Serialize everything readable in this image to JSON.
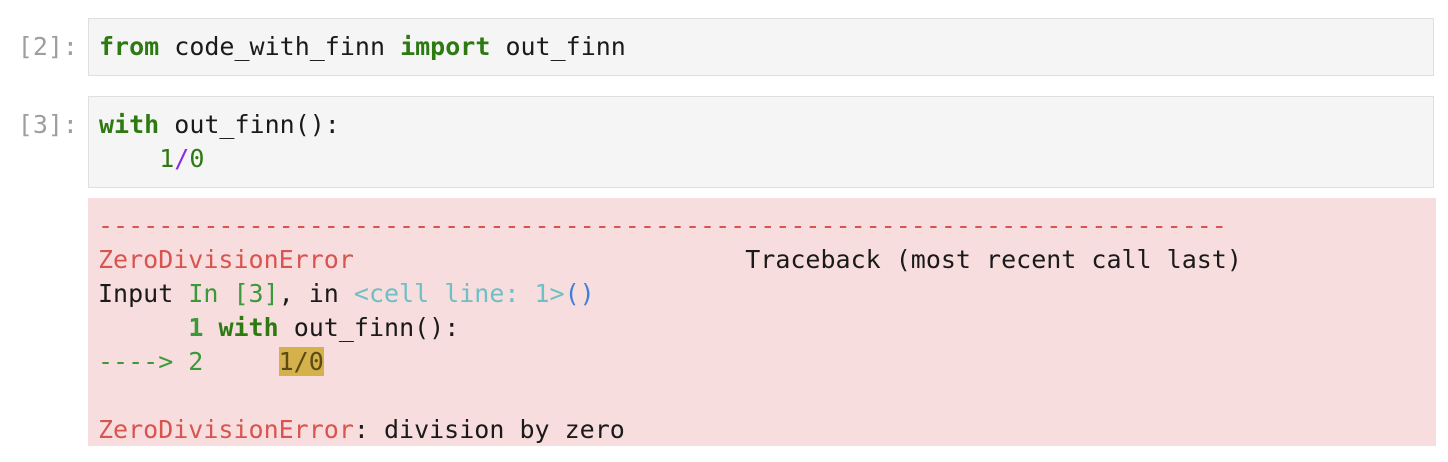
{
  "cell2": {
    "prompt": "[2]:",
    "kw_from": "from",
    "module": "code_with_finn",
    "kw_import": "import",
    "name": "out_finn"
  },
  "cell3": {
    "prompt": "[3]:",
    "kw_with": "with",
    "call": "out_finn():",
    "indent": "    ",
    "num1": "1",
    "op": "/",
    "num0": "0"
  },
  "traceback": {
    "dashes": "---------------------------------------------------------------------------",
    "error_name": "ZeroDivisionError",
    "gap": "                          ",
    "traceback_title": "Traceback (most recent call last)",
    "input_label": "Input ",
    "in_ref": "In [3]",
    "in_word": ", in ",
    "cell_line": "<cell line: 1>",
    "parens": "()",
    "line1_pad": "      ",
    "line1_num": "1",
    "line1_kw": "with",
    "line1_rest": " out_finn():",
    "arrow": "----> 2",
    "line2_pad": "     ",
    "line2_code": "1/0",
    "final_error_name": "ZeroDivisionError",
    "final_message": ": division by zero"
  }
}
